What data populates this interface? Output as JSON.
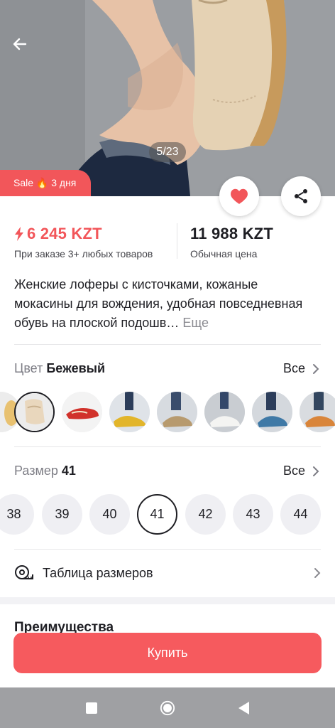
{
  "hero": {
    "image_counter": "5/23",
    "sale_badge": "Sale 🔥 3 дня"
  },
  "price": {
    "sale_price": "6 245 KZT",
    "sale_note": "При заказе 3+ любых товаров",
    "regular_price": "11 988 KZT",
    "regular_note": "Обычная цена"
  },
  "description": {
    "text": "Женские лоферы с кисточками, кожаные мокасины для вождения, удобная повседневная обувь на плоской подошв…",
    "more_label": "Еще"
  },
  "color": {
    "label": "Цвет",
    "value": "Бежевый",
    "all_label": "Все",
    "swatches": [
      "beige",
      "red",
      "yellow",
      "khaki",
      "white",
      "blue",
      "orange"
    ]
  },
  "size": {
    "label": "Размер",
    "value": "41",
    "all_label": "Все",
    "options": [
      "38",
      "39",
      "40",
      "41",
      "42",
      "43",
      "44"
    ],
    "selected": "41"
  },
  "size_table": {
    "label": "Таблица размеров"
  },
  "advantages": {
    "title": "Преимущества"
  },
  "buy_button": {
    "label": "Купить"
  },
  "colors": {
    "accent": "#f65a5e",
    "sale_price": "#f2565a",
    "nav_bar": "#9fa0a3"
  }
}
